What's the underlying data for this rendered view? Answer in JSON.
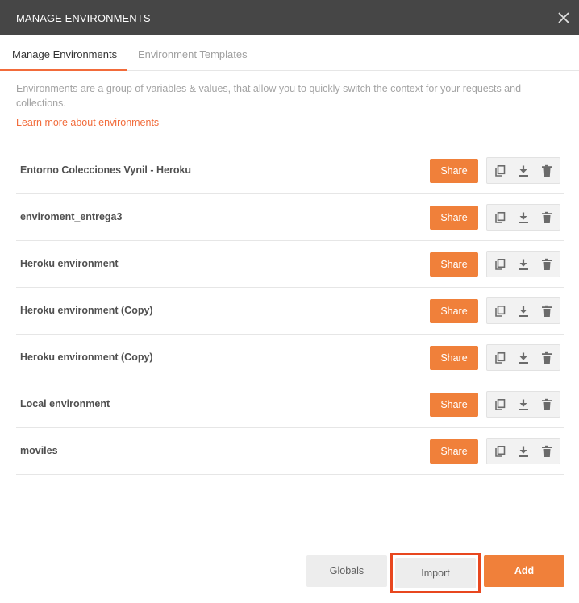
{
  "modal": {
    "title": "MANAGE ENVIRONMENTS"
  },
  "tabs": [
    {
      "label": "Manage Environments",
      "active": true
    },
    {
      "label": "Environment Templates",
      "active": false
    }
  ],
  "description": "Environments are a group of variables & values, that allow you to quickly switch the context for your requests and collections.",
  "learn_more": "Learn more about environments",
  "share_label": "Share",
  "environments": [
    {
      "name": "Entorno Colecciones Vynil - Heroku"
    },
    {
      "name": "enviroment_entrega3"
    },
    {
      "name": "Heroku environment"
    },
    {
      "name": "Heroku environment (Copy)"
    },
    {
      "name": "Heroku environment (Copy)"
    },
    {
      "name": "Local environment"
    },
    {
      "name": "moviles"
    }
  ],
  "row_icons": [
    "duplicate-icon",
    "download-icon",
    "trash-icon"
  ],
  "footer": {
    "globals": "Globals",
    "import": "Import",
    "add": "Add"
  },
  "colors": {
    "accent": "#f0803a",
    "header": "#464646",
    "highlight": "#e8471f"
  }
}
